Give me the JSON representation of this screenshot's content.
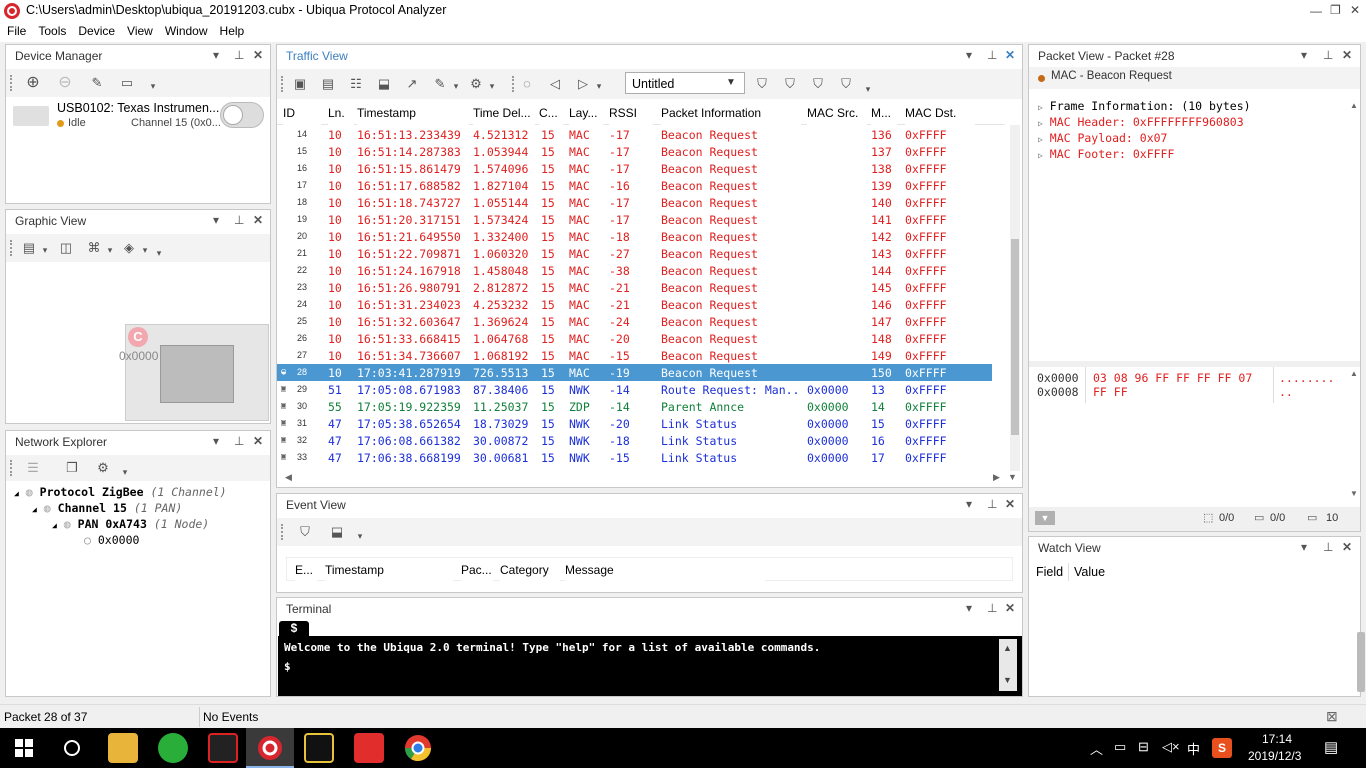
{
  "window": {
    "title": "C:\\Users\\admin\\Desktop\\ubiqua_20191203.cubx - Ubiqua Protocol Analyzer",
    "min": "—",
    "max": "❐",
    "close": "✕"
  },
  "menu": [
    "File",
    "Tools",
    "Device",
    "View",
    "Window",
    "Help"
  ],
  "panels": {
    "device_manager": {
      "title": "Device Manager",
      "device_name": "USB0102: Texas Instrumen...",
      "status": "Idle",
      "channel": "Channel 15 (0x0..."
    },
    "graphic_view": {
      "title": "Graphic View",
      "node_label": "0x0000",
      "coord_icon": "C"
    },
    "network_explorer": {
      "title": "Network Explorer",
      "tree": [
        {
          "label": "Protocol ZigBee",
          "note": "(1 Channel)"
        },
        {
          "label": "Channel 15",
          "note": "(1 PAN)"
        },
        {
          "label": "PAN 0xA743",
          "note": "(1 Node)"
        },
        {
          "label": "0x0000",
          "note": ""
        }
      ]
    },
    "traffic_view": {
      "title": "Traffic View",
      "file_combo": "Untitled",
      "columns": [
        "ID",
        "Ln.",
        "Timestamp",
        "Time Del...",
        "C...",
        "Lay...",
        "RSSI",
        "Packet Information",
        "MAC Src.",
        "M...",
        "MAC Dst."
      ],
      "rows": [
        {
          "id": "14",
          "ln": "10",
          "ts": "16:51:13.233439",
          "dt": "4.521312",
          "ch": "15",
          "layer": "MAC",
          "rssi": "-17",
          "info": "Beacon Request",
          "src": "",
          "seq": "136",
          "dst": "0xFFFF",
          "color": "red"
        },
        {
          "id": "15",
          "ln": "10",
          "ts": "16:51:14.287383",
          "dt": "1.053944",
          "ch": "15",
          "layer": "MAC",
          "rssi": "-17",
          "info": "Beacon Request",
          "src": "",
          "seq": "137",
          "dst": "0xFFFF",
          "color": "red"
        },
        {
          "id": "16",
          "ln": "10",
          "ts": "16:51:15.861479",
          "dt": "1.574096",
          "ch": "15",
          "layer": "MAC",
          "rssi": "-17",
          "info": "Beacon Request",
          "src": "",
          "seq": "138",
          "dst": "0xFFFF",
          "color": "red"
        },
        {
          "id": "17",
          "ln": "10",
          "ts": "16:51:17.688582",
          "dt": "1.827104",
          "ch": "15",
          "layer": "MAC",
          "rssi": "-16",
          "info": "Beacon Request",
          "src": "",
          "seq": "139",
          "dst": "0xFFFF",
          "color": "red"
        },
        {
          "id": "18",
          "ln": "10",
          "ts": "16:51:18.743727",
          "dt": "1.055144",
          "ch": "15",
          "layer": "MAC",
          "rssi": "-17",
          "info": "Beacon Request",
          "src": "",
          "seq": "140",
          "dst": "0xFFFF",
          "color": "red"
        },
        {
          "id": "19",
          "ln": "10",
          "ts": "16:51:20.317151",
          "dt": "1.573424",
          "ch": "15",
          "layer": "MAC",
          "rssi": "-17",
          "info": "Beacon Request",
          "src": "",
          "seq": "141",
          "dst": "0xFFFF",
          "color": "red"
        },
        {
          "id": "20",
          "ln": "10",
          "ts": "16:51:21.649550",
          "dt": "1.332400",
          "ch": "15",
          "layer": "MAC",
          "rssi": "-18",
          "info": "Beacon Request",
          "src": "",
          "seq": "142",
          "dst": "0xFFFF",
          "color": "red"
        },
        {
          "id": "21",
          "ln": "10",
          "ts": "16:51:22.709871",
          "dt": "1.060320",
          "ch": "15",
          "layer": "MAC",
          "rssi": "-27",
          "info": "Beacon Request",
          "src": "",
          "seq": "143",
          "dst": "0xFFFF",
          "color": "red"
        },
        {
          "id": "22",
          "ln": "10",
          "ts": "16:51:24.167918",
          "dt": "1.458048",
          "ch": "15",
          "layer": "MAC",
          "rssi": "-38",
          "info": "Beacon Request",
          "src": "",
          "seq": "144",
          "dst": "0xFFFF",
          "color": "red"
        },
        {
          "id": "23",
          "ln": "10",
          "ts": "16:51:26.980791",
          "dt": "2.812872",
          "ch": "15",
          "layer": "MAC",
          "rssi": "-21",
          "info": "Beacon Request",
          "src": "",
          "seq": "145",
          "dst": "0xFFFF",
          "color": "red"
        },
        {
          "id": "24",
          "ln": "10",
          "ts": "16:51:31.234023",
          "dt": "4.253232",
          "ch": "15",
          "layer": "MAC",
          "rssi": "-21",
          "info": "Beacon Request",
          "src": "",
          "seq": "146",
          "dst": "0xFFFF",
          "color": "red"
        },
        {
          "id": "25",
          "ln": "10",
          "ts": "16:51:32.603647",
          "dt": "1.369624",
          "ch": "15",
          "layer": "MAC",
          "rssi": "-24",
          "info": "Beacon Request",
          "src": "",
          "seq": "147",
          "dst": "0xFFFF",
          "color": "red"
        },
        {
          "id": "26",
          "ln": "10",
          "ts": "16:51:33.668415",
          "dt": "1.064768",
          "ch": "15",
          "layer": "MAC",
          "rssi": "-20",
          "info": "Beacon Request",
          "src": "",
          "seq": "148",
          "dst": "0xFFFF",
          "color": "red"
        },
        {
          "id": "27",
          "ln": "10",
          "ts": "16:51:34.736607",
          "dt": "1.068192",
          "ch": "15",
          "layer": "MAC",
          "rssi": "-15",
          "info": "Beacon Request",
          "src": "",
          "seq": "149",
          "dst": "0xFFFF",
          "color": "red"
        },
        {
          "id": "28",
          "ln": "10",
          "ts": "17:03:41.287919",
          "dt": "726.5513",
          "ch": "15",
          "layer": "MAC",
          "rssi": "-19",
          "info": "Beacon Request",
          "src": "",
          "seq": "150",
          "dst": "0xFFFF",
          "color": "selected"
        },
        {
          "id": "29",
          "ln": "51",
          "ts": "17:05:08.671983",
          "dt": "87.38406",
          "ch": "15",
          "layer": "NWK",
          "rssi": "-14",
          "info": "Route Request: Man...",
          "src": "0x0000",
          "seq": "13",
          "dst": "0xFFFF",
          "color": "blue"
        },
        {
          "id": "30",
          "ln": "55",
          "ts": "17:05:19.922359",
          "dt": "11.25037",
          "ch": "15",
          "layer": "ZDP",
          "rssi": "-14",
          "info": "Parent Annce",
          "src": "0x0000",
          "seq": "14",
          "dst": "0xFFFF",
          "color": "green"
        },
        {
          "id": "31",
          "ln": "47",
          "ts": "17:05:38.652654",
          "dt": "18.73029",
          "ch": "15",
          "layer": "NWK",
          "rssi": "-20",
          "info": "Link Status",
          "src": "0x0000",
          "seq": "15",
          "dst": "0xFFFF",
          "color": "blue"
        },
        {
          "id": "32",
          "ln": "47",
          "ts": "17:06:08.661382",
          "dt": "30.00872",
          "ch": "15",
          "layer": "NWK",
          "rssi": "-18",
          "info": "Link Status",
          "src": "0x0000",
          "seq": "16",
          "dst": "0xFFFF",
          "color": "blue"
        },
        {
          "id": "33",
          "ln": "47",
          "ts": "17:06:38.668199",
          "dt": "30.00681",
          "ch": "15",
          "layer": "NWK",
          "rssi": "-15",
          "info": "Link Status",
          "src": "0x0000",
          "seq": "17",
          "dst": "0xFFFF",
          "color": "blue"
        }
      ]
    },
    "event_view": {
      "title": "Event View",
      "columns": [
        "E...",
        "Timestamp",
        "Pac...",
        "Category",
        "Message"
      ]
    },
    "terminal": {
      "title": "Terminal",
      "tab": "$",
      "welcome": "Welcome to the Ubiqua 2.0 terminal! Type \"help\" for a list of available commands.",
      "prompt": "$"
    },
    "packet_view": {
      "title": "Packet View - Packet #28",
      "summary": "MAC - Beacon Request",
      "tree": [
        "Frame Information: (10 bytes)",
        "MAC Header: 0xFFFFFFFF960803",
        "MAC Payload: 0x07",
        "MAC Footer: 0xFFFF"
      ],
      "hex": [
        {
          "offset": "0x0000",
          "bytes": "03 08 96 FF FF FF FF 07",
          "ascii": "........"
        },
        {
          "offset": "0x0008",
          "bytes": "FF FF",
          "ascii": ".."
        }
      ],
      "footer": {
        "a": "0/0",
        "b": "0/0",
        "c": "10"
      }
    },
    "watch_view": {
      "title": "Watch View",
      "columns": [
        "Field",
        "Value"
      ]
    }
  },
  "status": {
    "packet": "Packet 28 of 37",
    "events": "No Events"
  },
  "taskbar": {
    "time": "17:14",
    "date": "2019/12/3",
    "ime": "中"
  },
  "colors": {
    "red": "#e02020",
    "blue": "#1c2fd8",
    "green": "#10803a",
    "selected_bg": "#4a97d2",
    "accent": "#3c7fc0"
  }
}
